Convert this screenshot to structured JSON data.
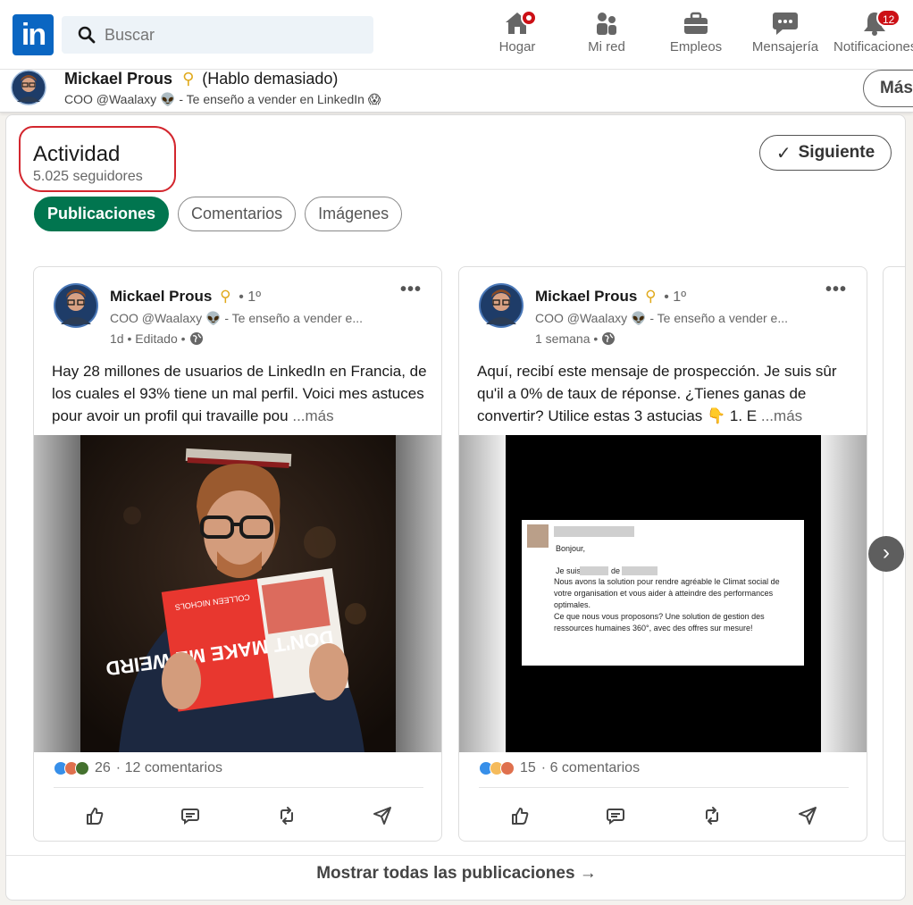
{
  "nav": {
    "search_placeholder": "Buscar",
    "items": [
      {
        "label": "Hogar",
        "icon": "home-icon"
      },
      {
        "label": "Mi red",
        "icon": "network-icon"
      },
      {
        "label": "Empleos",
        "icon": "briefcase-icon"
      },
      {
        "label": "Mensajería",
        "icon": "messaging-icon"
      },
      {
        "label": "Notificaciones",
        "icon": "bell-icon",
        "badge": "12"
      }
    ]
  },
  "profile_strip": {
    "name": "Mickael Prous",
    "name_extra": "(Hablo demasiado)",
    "headline": "COO @Waalaxy 👽 - Te enseño a vender en LinkedIn 😱",
    "more_button": "Más"
  },
  "activity": {
    "title": "Actividad",
    "followers": "5.025 seguidores",
    "follow_button": "Siguiente",
    "tabs": [
      "Publicaciones",
      "Comentarios",
      "Imágenes"
    ]
  },
  "posts": [
    {
      "author": "Mickael Prous",
      "degree": "• 1º",
      "headline": "COO @Waalaxy 👽 - Te enseño a vender e...",
      "time": "1d • Editado •",
      "text": "Hay 28 millones de usuarios de LinkedIn en Francia, de los cuales el 93% tiene un mal perfil. Voici mes astuces pour avoir un profil qui travaille pou",
      "more": "...más",
      "book_title": "DON'T MAKE ME WEIRD",
      "book_author": "COLLEEN NICHOLS",
      "reaction_count": "26",
      "comments": "· 12 comentarios"
    },
    {
      "author": "Mickael Prous",
      "degree": "• 1º",
      "headline": "COO @Waalaxy 👽 - Te enseño a vender e...",
      "time": "1 semana •",
      "text": "Aquí, recibí este mensaje de prospección. Je suis sûr qu'il a 0% de taux de réponse. ¿Tienes ganas de convertir? Utilice estas 3 astucias 👇 1. E",
      "more": "...más",
      "message": {
        "greeting": "Bonjour,",
        "line1": "Je suis",
        "line1b": "de",
        "body": "Nous avons la solution pour rendre agréable le Climat social de votre organisation et vous aider à atteindre des performances optimales.",
        "body2": "Ce que nous vous proposons? Une solution de gestion des ressources humaines 360°, avec des offres sur mesure!"
      },
      "reaction_count": "15",
      "comments": "· 6 comentarios"
    }
  ],
  "show_all": "Mostrar todas las publicaciones →",
  "colors": {
    "brand": "#0a66c2",
    "active_tab": "#01754f",
    "badge": "#cc1016",
    "highlight": "#d3262e"
  }
}
